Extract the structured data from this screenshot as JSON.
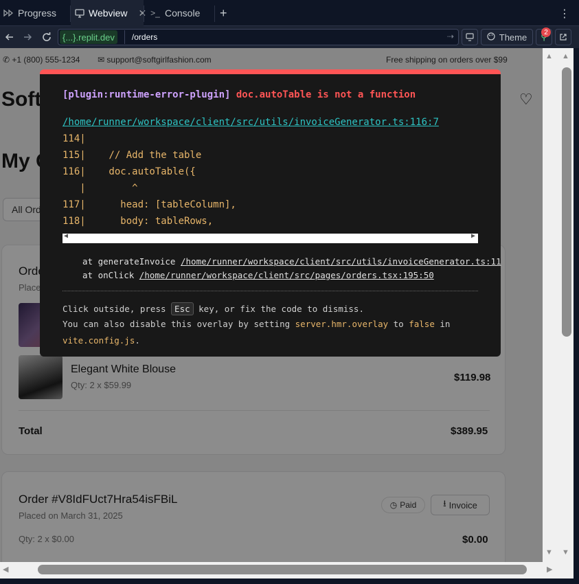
{
  "tabs": [
    {
      "label": "Progress",
      "icon": "progress-icon"
    },
    {
      "label": "Webview",
      "icon": "monitor-icon",
      "active": true
    },
    {
      "label": "Console",
      "icon": "terminal-icon"
    }
  ],
  "addressbar": {
    "domain": "{...}.replit.dev",
    "path": "/orders",
    "theme_label": "Theme",
    "badge_count": "2"
  },
  "site": {
    "phone": "+1 (800) 555-1234",
    "email": "support@softgirlfashion.com",
    "shipping_note": "Free shipping on orders over $99",
    "brand_partial": "Soft",
    "heading_partial": "My O",
    "filter_partial": "All Ord",
    "order1_title_partial": "Orde",
    "order1_placed_partial": "Placed",
    "order1_item2_name": "Elegant White Blouse",
    "order1_item2_qty": "Qty: 2 x $59.99",
    "order1_item2_price": "$119.98",
    "order1_total_label": "Total",
    "order1_total": "$389.95",
    "order2_title": "Order #V8IdFUct7Hra54isFBiL",
    "order2_placed": "Placed on March 31, 2025",
    "order2_status": "Paid",
    "order2_invoice": "Invoice",
    "order2_qty": "Qty: 2 x $0.00",
    "order2_price": "$0.00"
  },
  "overlay": {
    "plugin": "[plugin:runtime-error-plugin]",
    "message": "doc.autoTable is not a function",
    "file": "/home/runner/workspace/client/src/utils/invoiceGenerator.ts:116:7",
    "code_lines": [
      "114|",
      "115|    // Add the table",
      "116|    doc.autoTable({",
      "   |        ^",
      "117|      head: [tableColumn],",
      "118|      body: tableRows,"
    ],
    "stack1_prefix": "at generateInvoice ",
    "stack1_path": "/home/runner/workspace/client/src/utils/invoiceGenerator.ts:11",
    "stack2_prefix": "at onClick ",
    "stack2_path": "/home/runner/workspace/client/src/pages/orders.tsx:195:50",
    "tip1_a": "Click outside, press ",
    "tip1_key": "Esc",
    "tip1_b": " key, or fix the code to dismiss.",
    "tip2_a": "You can also disable this overlay by setting ",
    "tip2_setting": "server.hmr.overlay",
    "tip2_b": " to ",
    "tip2_false": "false",
    "tip2_c": " in",
    "tip3_file": "vite.config.js",
    "tip3_b": "."
  },
  "colors": {
    "ide_bg": "#0e1525",
    "overlay_bg": "#181818",
    "error_red": "#ff5555",
    "plugin_purple": "#cfa3ff",
    "file_cyan": "#2dc3c3",
    "code_yellow": "#e8b66a"
  }
}
